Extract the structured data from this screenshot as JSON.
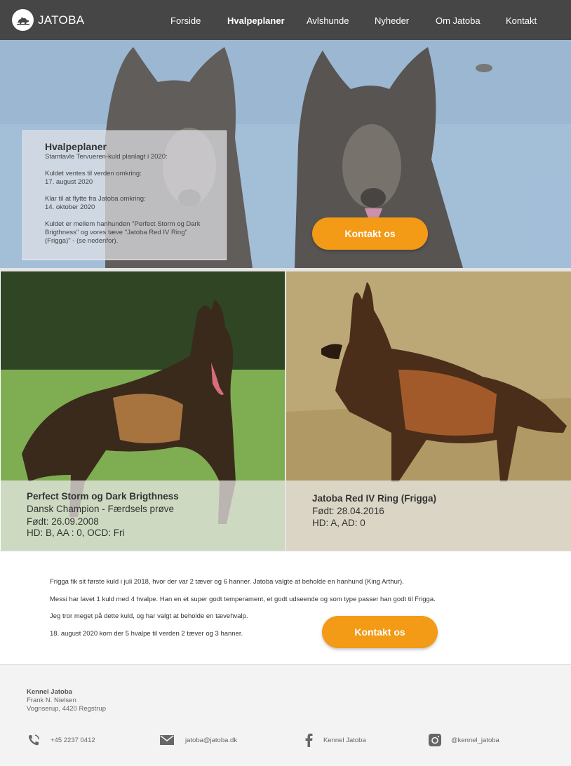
{
  "header": {
    "brand": "JATOBA",
    "nav": [
      {
        "label": "Forside",
        "active": false
      },
      {
        "label": "Hvalpeplaner",
        "active": true
      },
      {
        "label": "Avlshunde",
        "active": false
      },
      {
        "label": "Nyheder",
        "active": false
      },
      {
        "label": "Om Jatoba",
        "active": false
      },
      {
        "label": "Kontakt",
        "active": false
      }
    ]
  },
  "hero": {
    "title": "Hvalpeplaner",
    "lines": [
      "Stamtavle Tervueren-kuld planlagt i 2020:",
      "Kuldet ventes til verden omkring:",
      "17. august 2020",
      "Klar til at flytte fra Jatoba omkring:",
      "14. oktober 2020",
      "Kuldet er mellem hanhunden \"Perfect Storm og Dark Brigthness\" og vores tæve \"Jatoba Red IV Ring\" (Frigga)\" -  (se nedenfor)."
    ],
    "cta": "Kontakt os"
  },
  "dogs": {
    "male": {
      "name": "Perfect Storm og Dark Brigthness",
      "title": "Dansk Champion - Færdsels prøve",
      "born": "Født: 26.09.2008",
      "health": "HD:  B,    AA : 0,    OCD: Fri"
    },
    "female": {
      "name": "Jatoba Red IV Ring (Frigga)",
      "born": "Født: 28.04.2016",
      "health": "HD: A,     AD: 0"
    }
  },
  "info": {
    "lines": [
      "Frigga fik sit første kuld i juli 2018, hvor der var 2 tæver og 6 hanner. Jatoba valgte at beholde en hanhund (King Arthur).",
      "Messi har lavet 1 kuld med 4 hvalpe. Han en et super godt temperament, et godt udseende og som type passer han godt til Frigga.",
      "Jeg tror meget på dette kuld, og har valgt at beholde en tævehvalp.",
      "18. august 2020 kom der 5 hvalpe til verden 2 tæver og 3 hanner."
    ],
    "cta": "Kontakt os"
  },
  "footer": {
    "name": "Kennel Jatoba",
    "owner": "Frank N. Nielsen",
    "address": "Vognserup, 4420 Regstrup",
    "phone": "+45 2237 0412",
    "email": "jatoba@jatoba.dk",
    "facebook": "Kennel Jatoba",
    "instagram": "@kennel_jatoba"
  },
  "colors": {
    "header_bg": "#464646",
    "accent": "#f39a16"
  },
  "icons": [
    "dog-logo-icon",
    "phone-icon",
    "mail-icon",
    "facebook-icon",
    "instagram-icon"
  ]
}
